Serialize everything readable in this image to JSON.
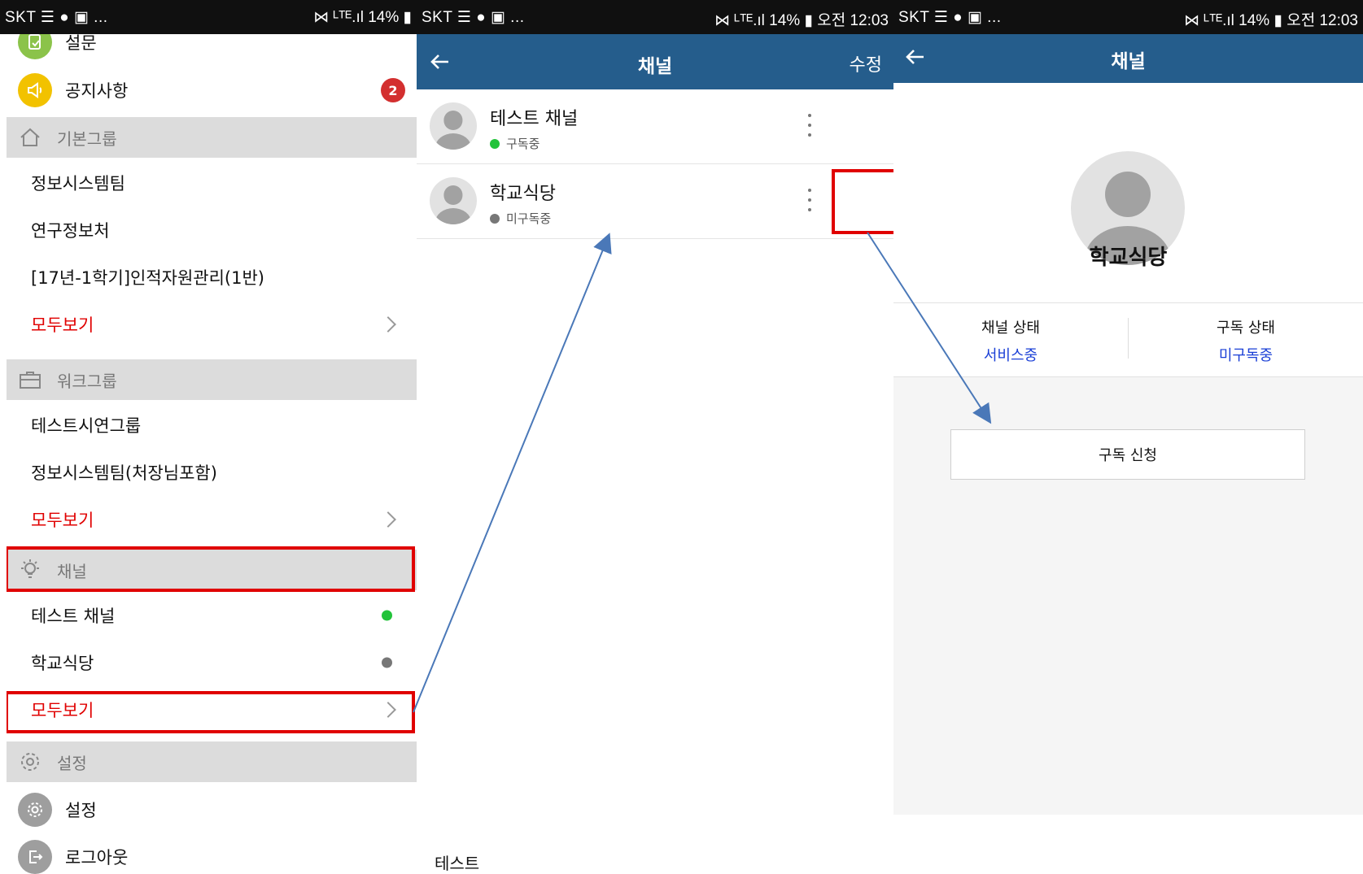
{
  "status_bars": [
    {
      "left": "SKT ☰ ● ▣ ...",
      "right": "⋈ ᴸᵀᴱ.ıl 14% ▮"
    },
    {
      "left": "SKT ☰ ● ▣ ...",
      "right": "⋈ ᴸᵀᴱ.ıl 14% ▮ 오전 12:03"
    },
    {
      "left": "SKT ☰ ● ▣ ...",
      "right": "⋈ ᴸᵀᴱ.ıl 14% ▮ 오전 12:03"
    }
  ],
  "menu": {
    "survey": "설문",
    "notice": "공지사항",
    "notice_badge": "2",
    "basic_group": {
      "header": "기본그룹",
      "items": [
        "정보시스템팀",
        "연구정보처",
        "[17년-1학기]인적자원관리(1반)"
      ],
      "more": "모두보기"
    },
    "work_group": {
      "header": "워크그룹",
      "items": [
        "테스트시연그룹",
        "정보시스템팀(처장님포함)"
      ],
      "more": "모두보기"
    },
    "channel": {
      "header": "채널",
      "items": [
        "테스트 채널",
        "학교식당"
      ],
      "more": "모두보기"
    },
    "settings": {
      "header": "설정",
      "item": "설정",
      "logout": "로그아웃"
    }
  },
  "channel_list": {
    "title": "채널",
    "edit": "수정",
    "channels": [
      {
        "name": "테스트 채널",
        "status": "구독중",
        "status_color": "#22c33a"
      },
      {
        "name": "학교식당",
        "status": "미구독중",
        "status_color": "#777777"
      }
    ],
    "footer_text": "테스트"
  },
  "channel_detail": {
    "title": "채널",
    "name": "학교식당",
    "channel_state_label": "채널 상태",
    "channel_state_value": "서비스중",
    "subscribe_state_label": "구독 상태",
    "subscribe_state_value": "미구독중",
    "subscribe_button": "구독 신청"
  },
  "colors": {
    "appbar": "#255d8c",
    "highlight": "#e00000",
    "more_link": "#e00000",
    "state_value": "#1a3fd6",
    "online": "#22c33a",
    "offline": "#777777"
  }
}
